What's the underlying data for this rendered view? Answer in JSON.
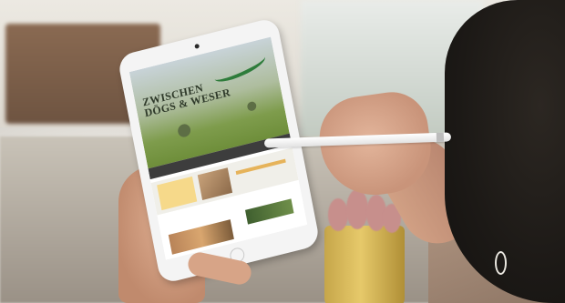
{
  "image": {
    "description_free": true
  },
  "tablet_screen": {
    "logo_line1": "ZWISCHEN",
    "logo_line2": "DÖGS & WESER",
    "logo_tagline": "",
    "nav_items": [
      "",
      "",
      "",
      ""
    ],
    "card_label": "",
    "section_title": ""
  },
  "colors": {
    "logo_green": "#2e7c3b",
    "nav_dark": "#3d3d3d",
    "card_yellow": "#f6d98a",
    "pot_gold": "#d9bb5a"
  }
}
